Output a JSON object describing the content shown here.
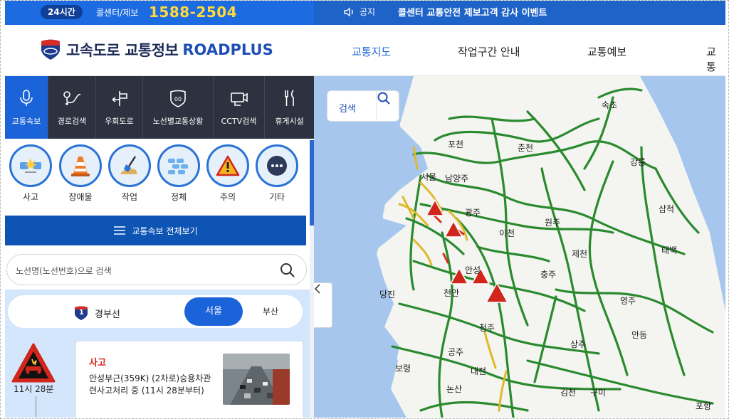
{
  "topbar": {
    "badge": "24시간",
    "callcenter_label": "콜센터/제보",
    "callcenter_number": "1588-2504",
    "notice_label": "공지",
    "notice_text": "콜센터 교통안전 제보고객 감사 이벤트"
  },
  "header": {
    "logo_text": "고속도로 교통정보",
    "logo_brand": "ROADPLUS",
    "nav": [
      "교통지도",
      "작업구간 안내",
      "교통예보",
      "교통"
    ],
    "nav_active_color": "#1b63d8"
  },
  "tabs": [
    {
      "label": "교통속보",
      "icon": "microphone-icon"
    },
    {
      "label": "경로검색",
      "icon": "route-icon"
    },
    {
      "label": "우회도로",
      "icon": "detour-icon"
    },
    {
      "label": "노선별교통상황",
      "icon": "route-shield-icon"
    },
    {
      "label": "CCTV검색",
      "icon": "cctv-icon"
    },
    {
      "label": "휴게시설",
      "icon": "restaurant-icon"
    }
  ],
  "categories": [
    {
      "label": "사고",
      "icon": "accident-icon"
    },
    {
      "label": "장애물",
      "icon": "traffic-cone-icon"
    },
    {
      "label": "작업",
      "icon": "shovel-icon"
    },
    {
      "label": "정체",
      "icon": "congestion-icon"
    },
    {
      "label": "주의",
      "icon": "warning-icon"
    },
    {
      "label": "기타",
      "icon": "more-icon"
    }
  ],
  "viewall_label": "교통속보 전체보기",
  "search_placeholder": "노선명(노선번호)으로 검색",
  "route": {
    "shield_number": "1",
    "name": "경부선",
    "dir_selected": "서울",
    "dir_other": "부산"
  },
  "incident": {
    "time": "11시 28분",
    "type": "사고",
    "description": "안성부근(359K) (2차로)승용차관련사고처리 중 (11시 28분부터)"
  },
  "map": {
    "search_label": "검색",
    "cities": [
      "속초",
      "포천",
      "춘천",
      "강릉",
      "서울",
      "남양주",
      "광주",
      "원주",
      "삼척",
      "이천",
      "태백",
      "제천",
      "충주",
      "당진",
      "안성",
      "천안",
      "영주",
      "청주",
      "안동",
      "상주",
      "공주",
      "보령",
      "대전",
      "논산",
      "김천",
      "구미",
      "포항"
    ],
    "colors": {
      "road_free": "#2a8a2e",
      "road_slow": "#e0b82a",
      "road_jam": "#d9301e",
      "sea": "#a6c6ee",
      "land": "#f4f4f1"
    }
  }
}
